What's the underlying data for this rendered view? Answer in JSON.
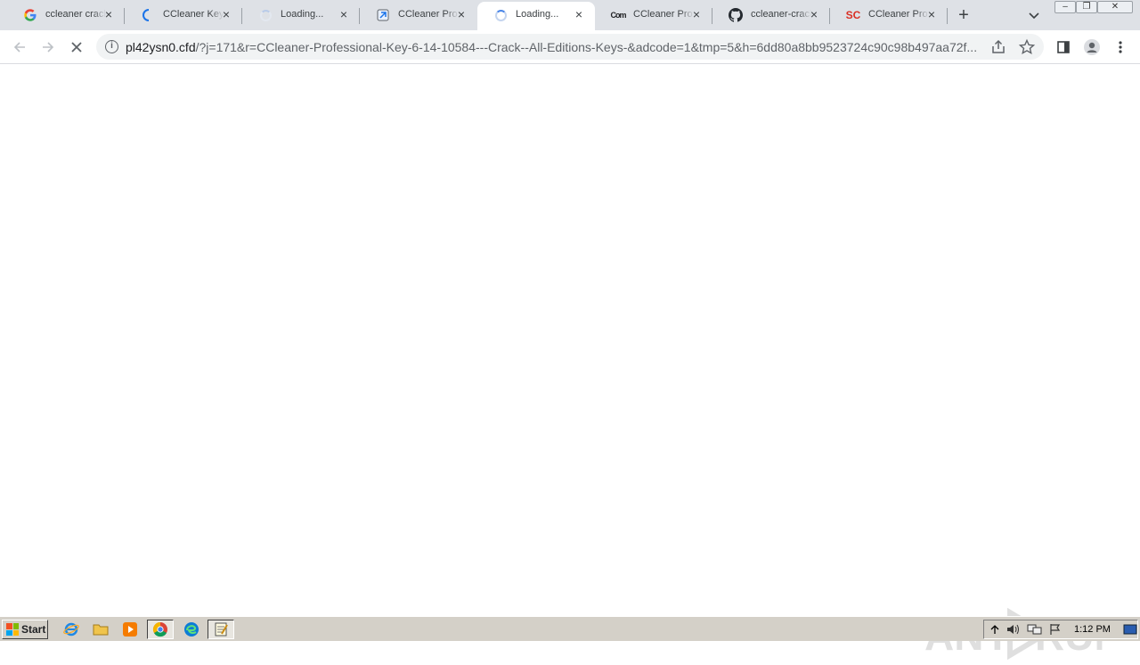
{
  "tabs": [
    {
      "title": "ccleaner crack",
      "favicon": "google-g-icon",
      "close": "×"
    },
    {
      "title": "CCleaner Key",
      "favicon": "loading-arc-icon",
      "close": "×"
    },
    {
      "title": "Loading...",
      "favicon": "loading-spinner-icon",
      "close": "×"
    },
    {
      "title": "CCleaner Prof",
      "favicon": "site-icon",
      "close": "×"
    },
    {
      "title": "Loading...",
      "favicon": "loading-spinner-icon",
      "close": "×",
      "active": true
    },
    {
      "title": "CCleaner Pro",
      "favicon": "com-icon",
      "favicon_text": "Com",
      "close": "×"
    },
    {
      "title": "ccleaner-crack",
      "favicon": "github-icon",
      "close": "×"
    },
    {
      "title": "CCleaner Prof",
      "favicon": "sc-icon",
      "favicon_text": "SC",
      "close": "×"
    }
  ],
  "new_tab_label": "+",
  "window_buttons": {
    "minimize": "‒",
    "restore": "❐",
    "close": "✕"
  },
  "omnibox": {
    "info": "i",
    "url_host": "pl42ysn0.cfd",
    "url_rest": "/?j=171&r=CCleaner-Professional-Key-6-14-10584---Crack--All-Editions-Keys-&adcode=1&tmp=5&h=6dd80a8bb9523724c90c98b497aa72f..."
  },
  "watermark": "ANY RUN",
  "taskbar": {
    "start_label": "Start",
    "quick_icons": [
      "internet-explorer-icon",
      "folder-icon",
      "media-player-icon",
      "chrome-icon",
      "edge-icon",
      "notepad-icon"
    ],
    "clock": "1:12 PM"
  },
  "colors": {
    "tabstrip": "#dee1e6",
    "accent_blue": "#4a86e8",
    "taskbar": "#d4d0c8"
  }
}
